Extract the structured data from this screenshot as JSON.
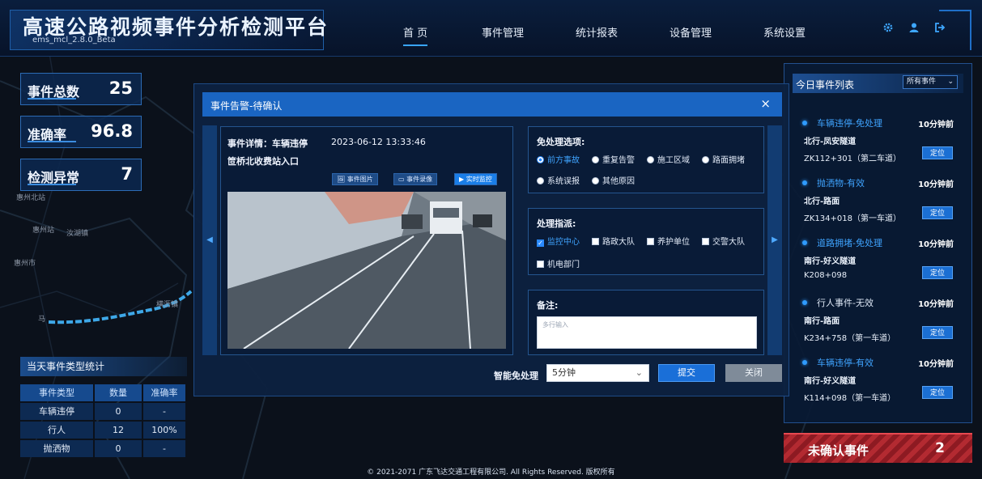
{
  "header": {
    "title": "高速公路视频事件分析检测平台",
    "version": "ems_mcl_2.8.0_Beta",
    "nav": [
      "首 页",
      "事件管理",
      "统计报表",
      "设备管理",
      "系统设置"
    ],
    "active_nav": "首 页",
    "icons": [
      "gear-icon",
      "user-icon",
      "logout-icon"
    ]
  },
  "stats": [
    {
      "label": "事件总数",
      "value": "25"
    },
    {
      "label": "准确率",
      "value": "96.8"
    },
    {
      "label": "检测异常",
      "value": "7"
    }
  ],
  "map": {
    "places": [
      "惠州北站",
      "惠州站",
      "汝湖镇",
      "惠州市",
      "横沥镇",
      "马"
    ]
  },
  "type_stats": {
    "title": "当天事件类型统计",
    "columns": [
      "事件类型",
      "数量",
      "准确率"
    ],
    "rows": [
      [
        "车辆违停",
        "0",
        "-"
      ],
      [
        "行人",
        "12",
        "100%"
      ],
      [
        "抛洒物",
        "0",
        "-"
      ]
    ]
  },
  "today_events": {
    "title": "今日事件列表",
    "filter": "所有事件",
    "locate_label": "定位",
    "items": [
      {
        "title": "车辆违停-免处理",
        "time": "10分钟前",
        "road": "北行-凤安隧道",
        "pos": "ZK112+301（第二车道）"
      },
      {
        "title": "抛洒物-有效",
        "time": "10分钟前",
        "road": "北行-路面",
        "pos": "ZK134+018（第一车道）"
      },
      {
        "title": "道路拥堵-免处理",
        "time": "10分钟前",
        "road": "南行-好义隧道",
        "pos": "K208+098"
      },
      {
        "title": "行人事件-无效",
        "time": "10分钟前",
        "road": "南行-路面",
        "pos": "K234+758（第一车道）"
      },
      {
        "title": "车辆违停-有效",
        "time": "10分钟前",
        "road": "南行-好义隧道",
        "pos": "K114+098（第一车道）"
      }
    ]
  },
  "unconfirmed": {
    "label": "未确认事件",
    "count": "2"
  },
  "footer": "© 2021-2071 广东飞达交通工程有限公司. All Rights Reserved. 版权所有",
  "modal": {
    "title": "事件告警-待确认",
    "close": "×",
    "detail_label": "事件详情：车辆违停",
    "detail_time": "2023-06-12 13:33:46",
    "detail_location": "笸桥北收费站入口",
    "media_buttons": [
      "事件图片",
      "事件录像",
      "实时监控"
    ],
    "exempt_title": "免处理选项:",
    "exempt_options": [
      "前方事故",
      "重复告警",
      "施工区域",
      "路面拥堵",
      "系统误报",
      "其他原因"
    ],
    "exempt_selected": "前方事故",
    "dispatch_title": "处理指派:",
    "dispatch_options": [
      "监控中心",
      "路政大队",
      "养护单位",
      "交警大队",
      "机电部门"
    ],
    "dispatch_checked": [
      "监控中心"
    ],
    "remark_title": "备注:",
    "remark_placeholder": "多行输入",
    "auto_label": "智能免处理",
    "auto_value": "5分钟",
    "submit": "提交",
    "cancel": "关闭"
  },
  "colors": {
    "accent": "#1a6fd8",
    "highlight": "#3fa4ff",
    "alert": "#b32a31"
  }
}
